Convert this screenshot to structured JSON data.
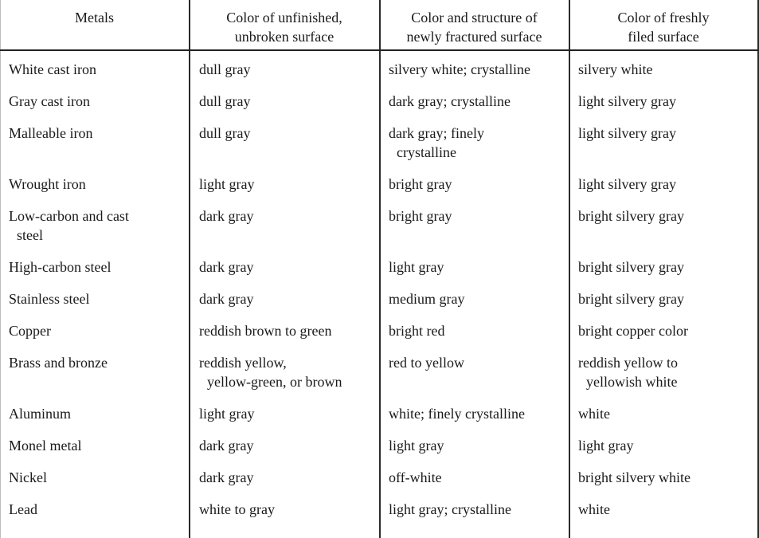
{
  "table": {
    "headers": [
      [
        "Metals"
      ],
      [
        "Color of unfinished,",
        "unbroken surface"
      ],
      [
        "Color and structure of",
        "newly fractured surface"
      ],
      [
        "Color of freshly",
        "filed surface"
      ]
    ],
    "rows": [
      {
        "metal": [
          "White cast iron"
        ],
        "unfinished": [
          "dull gray"
        ],
        "fractured": [
          "silvery white;  crystalline"
        ],
        "filed": [
          "silvery white"
        ]
      },
      {
        "metal": [
          "Gray cast iron"
        ],
        "unfinished": [
          "dull gray"
        ],
        "fractured": [
          "dark gray; crystalline"
        ],
        "filed": [
          "light silvery gray"
        ]
      },
      {
        "metal": [
          "Malleable iron"
        ],
        "unfinished": [
          "dull gray"
        ],
        "fractured": [
          "dark gray; finely",
          "crystalline"
        ],
        "filed": [
          "light silvery gray"
        ]
      },
      {
        "metal": [
          "Wrought iron"
        ],
        "unfinished": [
          "light gray"
        ],
        "fractured": [
          "bright gray"
        ],
        "filed": [
          "light silvery gray"
        ]
      },
      {
        "metal": [
          "Low-carbon and cast",
          "steel"
        ],
        "unfinished": [
          "dark gray"
        ],
        "fractured": [
          "bright gray"
        ],
        "filed": [
          "bright silvery gray"
        ]
      },
      {
        "metal": [
          "High-carbon steel"
        ],
        "unfinished": [
          "dark gray"
        ],
        "fractured": [
          "light gray"
        ],
        "filed": [
          "bright silvery gray"
        ]
      },
      {
        "metal": [
          "Stainless steel"
        ],
        "unfinished": [
          "dark gray"
        ],
        "fractured": [
          "medium gray"
        ],
        "filed": [
          "bright silvery gray"
        ]
      },
      {
        "metal": [
          "Copper"
        ],
        "unfinished": [
          "reddish brown to green"
        ],
        "fractured": [
          "bright red"
        ],
        "filed": [
          "bright copper color"
        ]
      },
      {
        "metal": [
          "Brass and bronze"
        ],
        "unfinished": [
          "reddish yellow,",
          "yellow-green, or brown"
        ],
        "fractured": [
          "red to yellow"
        ],
        "filed": [
          "reddish yellow to",
          "yellowish white"
        ]
      },
      {
        "metal": [
          "Aluminum"
        ],
        "unfinished": [
          "light gray"
        ],
        "fractured": [
          "white; finely crystalline"
        ],
        "filed": [
          "white"
        ]
      },
      {
        "metal": [
          "Monel metal"
        ],
        "unfinished": [
          "dark gray"
        ],
        "fractured": [
          "light gray"
        ],
        "filed": [
          "light gray"
        ]
      },
      {
        "metal": [
          "Nickel"
        ],
        "unfinished": [
          "dark gray"
        ],
        "fractured": [
          "off-white"
        ],
        "filed": [
          "bright silvery white"
        ]
      },
      {
        "metal": [
          "Lead"
        ],
        "unfinished": [
          "white to gray"
        ],
        "fractured": [
          "light gray; crystalline"
        ],
        "filed": [
          "white"
        ]
      }
    ]
  }
}
